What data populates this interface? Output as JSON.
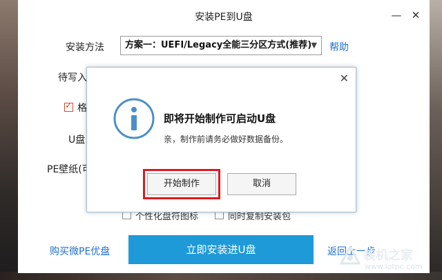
{
  "window": {
    "title": "安装PE到U盘",
    "minimize": "—",
    "close": "✕"
  },
  "form": {
    "method_label": "安装方法",
    "method_value": "方案一：UEFI/Legacy全能三分区方式(推荐)",
    "help": "帮助",
    "target_label": "待写入",
    "format_label": "格",
    "udisk_label": "U盘",
    "wallpaper_label": "PE壁纸(可",
    "personalize_icon": "个性化盘符图标",
    "copy_package": "同时复制安装包",
    "buy_link": "购买微PE优盘",
    "install_button": "立即安装进U盘",
    "back_link": "返回上一步"
  },
  "dialog": {
    "close": "✕",
    "title": "即将开始制作可启动U盘",
    "message": "亲，制作前请务必做好数据备份。",
    "confirm": "开始制作",
    "cancel": "取消"
  },
  "watermark": {
    "text": "装机之家",
    "url": "www.lotpc.com"
  },
  "colors": {
    "accent": "#1e9ad8",
    "link": "#1e6fd0",
    "highlight": "#e0181e"
  }
}
